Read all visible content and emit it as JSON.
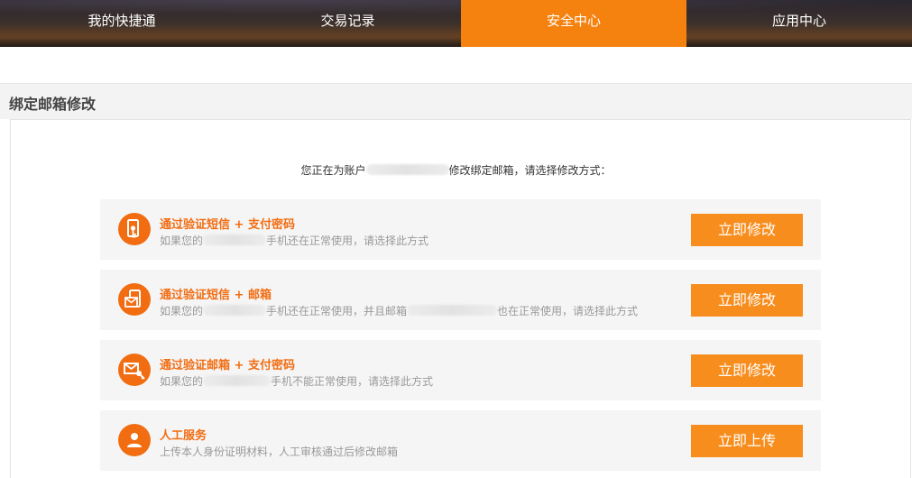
{
  "nav": {
    "tabs": [
      {
        "label": "我的快捷通",
        "active": false
      },
      {
        "label": "交易记录",
        "active": false
      },
      {
        "label": "安全中心",
        "active": true
      },
      {
        "label": "应用中心",
        "active": false
      }
    ]
  },
  "page_title": "绑定邮箱修改",
  "intro": {
    "before": "您正在为账户",
    "after": "修改绑定邮箱，请选择修改方式："
  },
  "options": [
    {
      "icon": "phone-key-icon",
      "title": "通过验证短信 + 支付密码",
      "desc_before": "如果您的",
      "desc_after": "手机还在正常使用，请选择此方式",
      "button": "立即修改"
    },
    {
      "icon": "phone-mail-icon",
      "title": "通过验证短信 + 邮箱",
      "desc_before": "如果您的",
      "desc_middle": "手机还在正常使用，并且邮箱",
      "desc_after": "也在正常使用，请选择此方式",
      "button": "立即修改"
    },
    {
      "icon": "mail-key-icon",
      "title": "通过验证邮箱 + 支付密码",
      "desc_before": "如果您的",
      "desc_after": "手机不能正常使用，请选择此方式",
      "button": "立即修改"
    },
    {
      "icon": "person-icon",
      "title": "人工服务",
      "desc": "上传本人身份证明材料，人工审核通过后修改邮箱",
      "button": "立即上传"
    }
  ],
  "colors": {
    "accent": "#f5820f",
    "button": "#f78d1d",
    "icon_bg": "#f26d12",
    "row_bg": "#f5f5f5"
  }
}
